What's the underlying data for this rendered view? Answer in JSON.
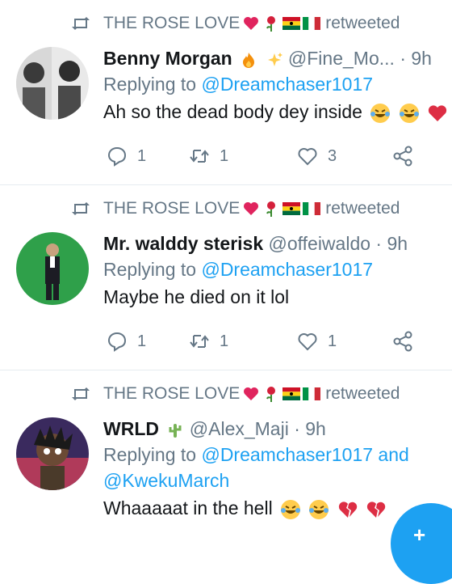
{
  "tweets": [
    {
      "retweeter": "THE ROSE LOVE",
      "retweeted_label": "retweeted",
      "name": "Benny Morgan",
      "handle": "@Fine_Mo...",
      "time": "· 9h",
      "reply_prefix": "Replying to",
      "reply_to": "@Dreamchaser1017",
      "text": "Ah so the dead body dey inside",
      "reply_count": "1",
      "retweet_count": "1",
      "like_count": "3"
    },
    {
      "retweeter": "THE ROSE LOVE",
      "retweeted_label": "retweeted",
      "name": "Mr. walddy sterisk",
      "handle": "@offeiwaldo",
      "time": "· 9h",
      "reply_prefix": "Replying to",
      "reply_to": "@Dreamchaser1017",
      "text": "Maybe he died on it lol",
      "reply_count": "1",
      "retweet_count": "1",
      "like_count": "1"
    },
    {
      "retweeter": "THE ROSE LOVE",
      "retweeted_label": "retweeted",
      "name": "WRLD",
      "handle": "@Alex_Maji",
      "time": "· 9h",
      "reply_prefix": "Replying to",
      "reply_to": "@Dreamchaser1017",
      "reply_and": "and",
      "reply_to_2": "@KwekuMarch",
      "text": "Whaaaaat in the hell"
    }
  ],
  "fab": {
    "icon": "compose-icon",
    "label": "+"
  },
  "colors": {
    "accent": "#1da1f2",
    "muted": "#657786",
    "text": "#14171a"
  }
}
